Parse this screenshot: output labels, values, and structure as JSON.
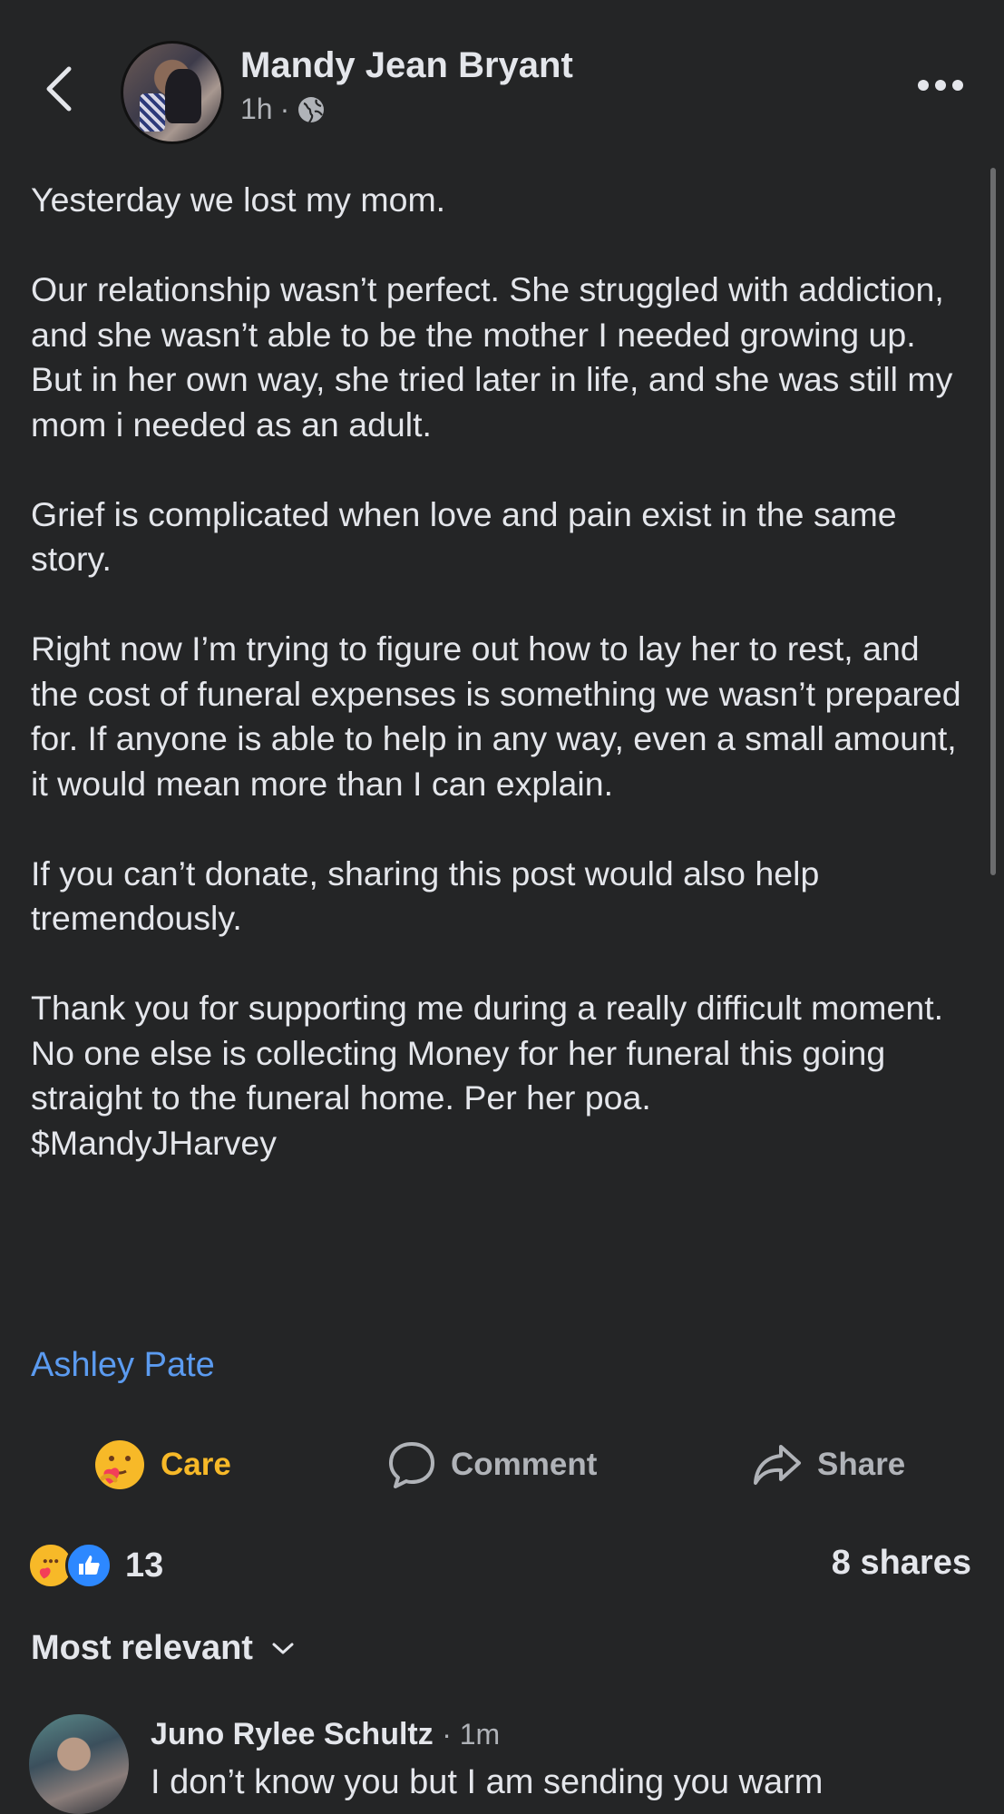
{
  "header": {
    "author": "Mandy Jean Bryant",
    "time": "1h",
    "separator": "·"
  },
  "post": {
    "paragraphs": [
      "Yesterday we lost my mom.",
      "Our relationship wasn’t perfect. She struggled with addiction, and she wasn’t able to be the mother I needed growing up. But in her own way, she tried later in life, and she was still my mom i needed as an adult.",
      "Grief is complicated when love and pain exist in the same story.",
      "Right now I’m trying to figure out how to lay her to rest, and the cost of funeral expenses is something we wasn’t prepared for. If anyone is able to help in any way, even a small amount, it would mean more than I can explain.",
      "If you can’t donate, sharing this post would also help tremendously.",
      "Thank you for supporting me during a really difficult moment.",
      "No one else is collecting Money for her funeral this going straight to the funeral home. Per her poa.",
      "$MandyJHarvey"
    ],
    "tag": "Ashley Pate"
  },
  "actions": {
    "care": "Care",
    "comment": "Comment",
    "share": "Share"
  },
  "stats": {
    "reaction_count": "13",
    "shares": "8 shares"
  },
  "sort": "Most relevant",
  "comment": {
    "author": "Juno Rylee Schultz",
    "time": "1m",
    "text": "I don’t know you but I am sending you warm"
  },
  "colors": {
    "background": "#242526",
    "text": "#e4e6eb",
    "muted": "#b0b3b8",
    "link": "#5b9bf0",
    "care": "#f7b928",
    "like": "#2d88ff"
  },
  "icons": [
    "back-chevron-icon",
    "globe-icon",
    "more-dots-icon",
    "care-emoji-icon",
    "comment-bubble-icon",
    "share-arrow-icon",
    "like-thumb-icon",
    "chevron-down-icon"
  ]
}
